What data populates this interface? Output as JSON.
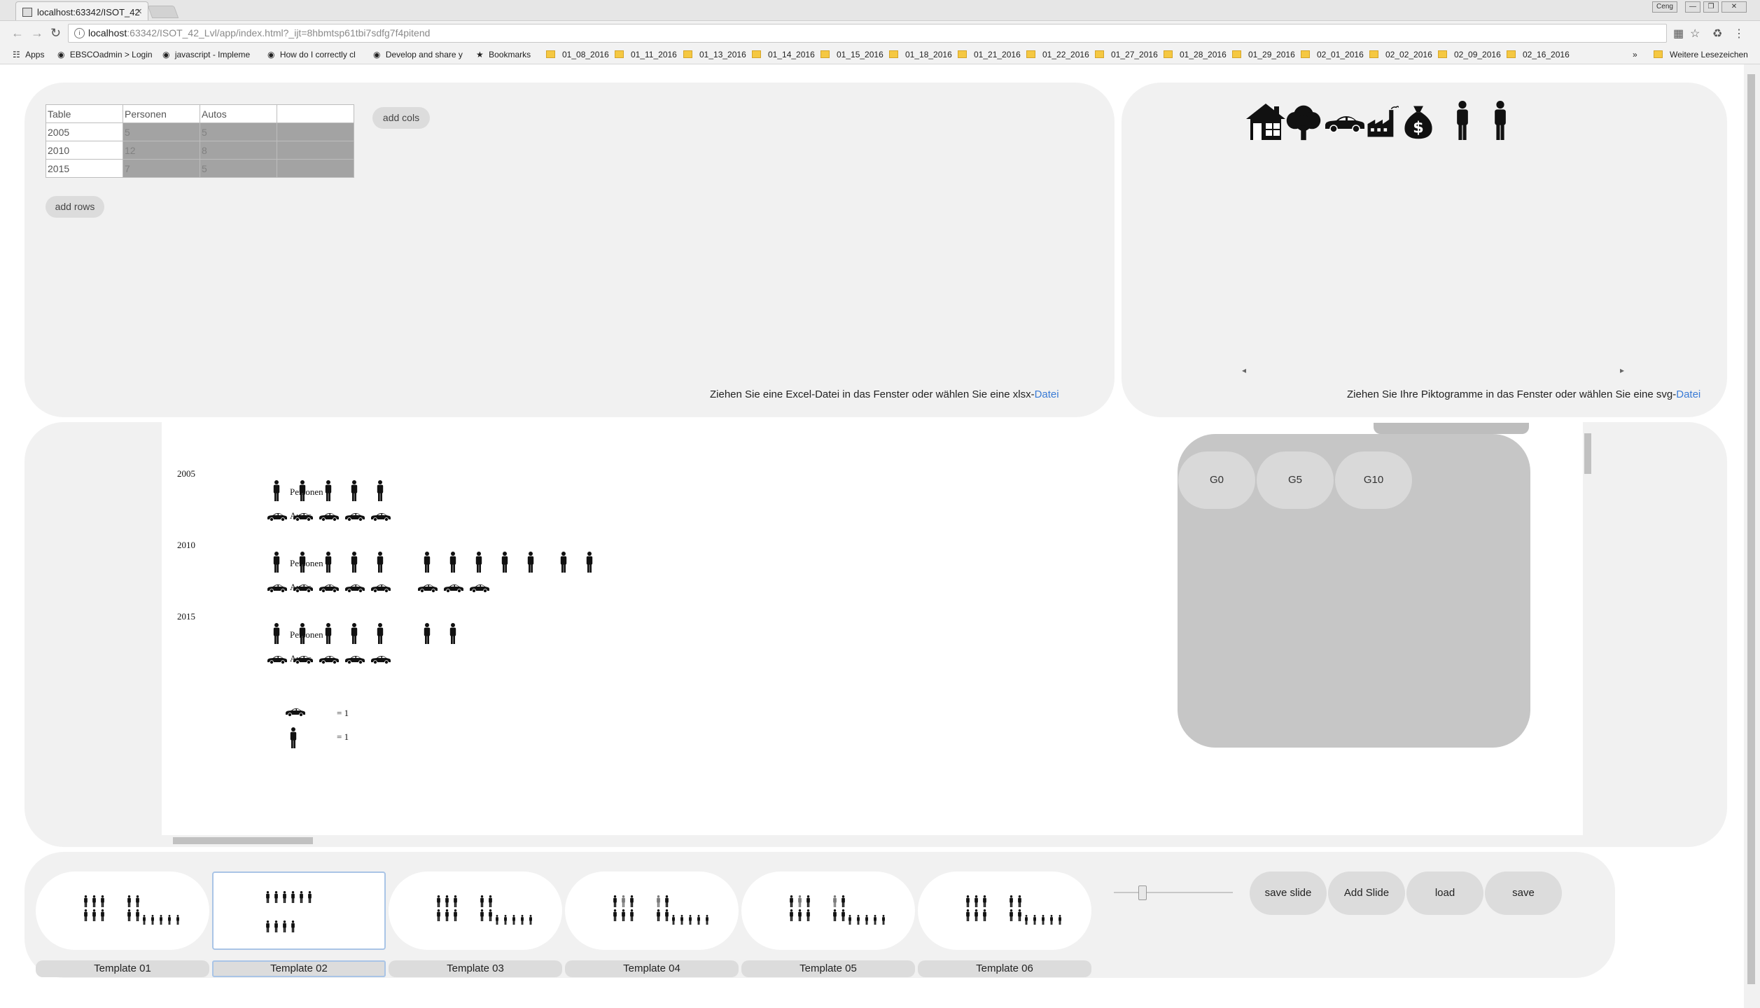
{
  "browser": {
    "tab_title": "localhost:63342/ISOT_42",
    "tab_close": "×",
    "window_buttons": [
      "Ceng",
      "—",
      "❐",
      "✕"
    ],
    "url_host": "localhost",
    "url_rest": ":63342/ISOT_42_Lvl/app/index.html?_ijt=8hbmtsp61tbi7sdfg7f4pitend",
    "bookmarks": [
      "Apps",
      "EBSCOadmin > Login",
      "javascript - Impleme",
      "How do I correctly cl",
      "Develop and share y",
      "Bookmarks",
      "01_08_2016",
      "01_11_2016",
      "01_13_2016",
      "01_14_2016",
      "01_15_2016",
      "01_18_2016",
      "01_21_2016",
      "01_22_2016",
      "01_27_2016",
      "01_28_2016",
      "01_29_2016",
      "02_01_2016",
      "02_02_2016",
      "02_09_2016",
      "02_16_2016"
    ],
    "bookmarks_more": "»",
    "bookmarks_other": "Weitere Lesezeichen"
  },
  "data_panel": {
    "table": {
      "header": [
        "Table",
        "Personen",
        "Autos",
        ""
      ],
      "rows": [
        [
          "2005",
          "5",
          "5",
          ""
        ],
        [
          "2010",
          "12",
          "8",
          ""
        ],
        [
          "2015",
          "7",
          "5",
          ""
        ]
      ]
    },
    "add_cols_label": "add cols",
    "add_rows_label": "add rows",
    "drop_hint": "Ziehen Sie eine Excel-Datei in das Fenster oder wählen Sie eine xlsx-",
    "drop_link": "Datei"
  },
  "icons_panel": {
    "icons": [
      "house-icon",
      "tree-icon",
      "car-icon",
      "factory-icon",
      "money-bag-icon",
      "person-icon",
      "person-icon"
    ],
    "drop_hint": "Ziehen Sie Ihre Piktogramme in das Fenster oder wählen Sie eine svg-",
    "drop_link": "Datei",
    "scroll_left": "◂",
    "scroll_right": "▸"
  },
  "chart_data": {
    "type": "pictogram",
    "categories": [
      "2005",
      "2010",
      "2015"
    ],
    "series": [
      {
        "name": "Personen",
        "icon": "person-icon",
        "values": [
          5,
          12,
          7
        ]
      },
      {
        "name": "Autos",
        "icon": "car-icon",
        "values": [
          5,
          8,
          5
        ]
      }
    ],
    "legend": [
      {
        "icon": "car-icon",
        "label": "= 1"
      },
      {
        "icon": "person-icon",
        "label": "= 1"
      }
    ]
  },
  "groups": {
    "buttons": [
      "G0",
      "G5",
      "G10"
    ]
  },
  "bottom_bar": {
    "templates": [
      "Template 01",
      "Template 02",
      "Template 03",
      "Template 04",
      "Template 05",
      "Template 06"
    ],
    "selected_template": 1,
    "slider_value": 0.25,
    "buttons": {
      "save_slide": "save slide",
      "add_slide": "Add Slide",
      "load": "load",
      "save": "save"
    }
  },
  "colors": {
    "accent_link": "#3a7bd5",
    "panel_bg": "#f1f1f1",
    "selection": "#a9c4e6"
  }
}
